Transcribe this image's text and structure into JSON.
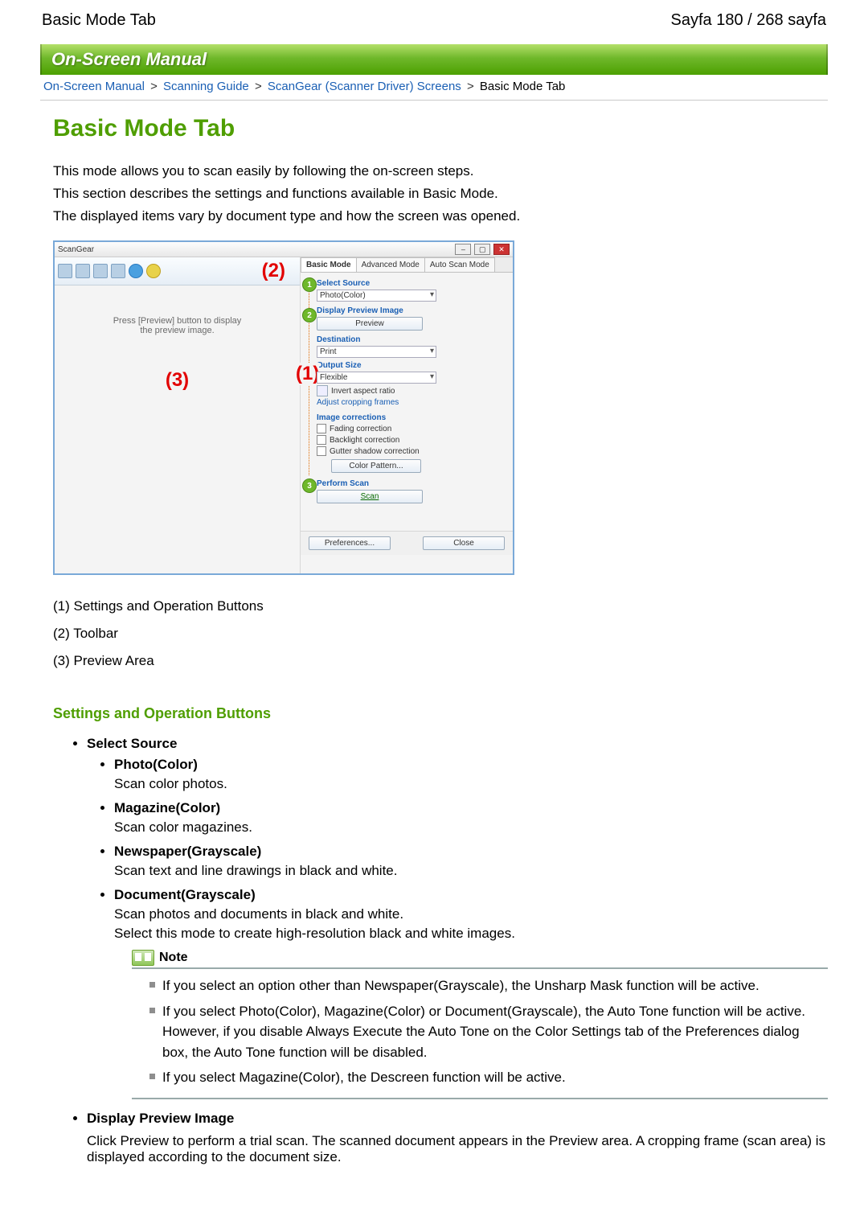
{
  "header": {
    "left": "Basic Mode Tab",
    "right": "Sayfa 180 / 268 sayfa"
  },
  "banner": "On-Screen Manual",
  "breadcrumb": {
    "items": [
      "On-Screen Manual",
      "Scanning Guide",
      "ScanGear (Scanner Driver) Screens"
    ],
    "current": "Basic Mode Tab",
    "sep": ">"
  },
  "title": "Basic Mode Tab",
  "intro": {
    "p1": "This mode allows you to scan easily by following the on-screen steps.",
    "p2": "This section describes the settings and functions available in Basic Mode.",
    "p3": "The displayed items vary by document type and how the screen was opened."
  },
  "shot": {
    "window_title": "ScanGear",
    "callouts": {
      "one": "(1)",
      "two": "(2)",
      "three": "(3)"
    },
    "preview_msg1": "Press [Preview] button to display",
    "preview_msg2": "the preview image.",
    "tabs": {
      "basic": "Basic Mode",
      "advanced": "Advanced Mode",
      "auto": "Auto Scan Mode"
    },
    "panel": {
      "select_source": "Select Source",
      "select_source_val": "Photo(Color)",
      "display_preview": "Display Preview Image",
      "preview_btn": "Preview",
      "destination": "Destination",
      "destination_val": "Print",
      "output_size": "Output Size",
      "output_size_val": "Flexible",
      "invert": "Invert aspect ratio",
      "adjust_crop": "Adjust cropping frames",
      "image_corrections": "Image corrections",
      "fading": "Fading correction",
      "backlight": "Backlight correction",
      "gutter": "Gutter shadow correction",
      "color_pattern": "Color Pattern...",
      "perform_scan": "Perform Scan",
      "scan_btn": "Scan",
      "preferences": "Preferences...",
      "close": "Close"
    }
  },
  "legend": {
    "l1": "(1) Settings and Operation Buttons",
    "l2": "(2) Toolbar",
    "l3": "(3) Preview Area"
  },
  "section1": "Settings and Operation Buttons",
  "ss": {
    "title": "Select Source",
    "photo_t": "Photo(Color)",
    "photo_d": "Scan color photos.",
    "mag_t": "Magazine(Color)",
    "mag_d": "Scan color magazines.",
    "news_t": "Newspaper(Grayscale)",
    "news_d": "Scan text and line drawings in black and white.",
    "doc_t": "Document(Grayscale)",
    "doc_d1": "Scan photos and documents in black and white.",
    "doc_d2": "Select this mode to create high-resolution black and white images."
  },
  "note": {
    "title": "Note",
    "n1": "If you select an option other than Newspaper(Grayscale), the Unsharp Mask function will be active.",
    "n2": "If you select Photo(Color), Magazine(Color) or Document(Grayscale), the Auto Tone function will be active. However, if you disable Always Execute the Auto Tone on the Color Settings tab of the Preferences dialog box, the Auto Tone function will be disabled.",
    "n3": "If you select Magazine(Color), the Descreen function will be active."
  },
  "dpi": {
    "title": "Display Preview Image",
    "desc": "Click Preview to perform a trial scan. The scanned document appears in the Preview area. A cropping frame (scan area) is displayed according to the document size."
  }
}
